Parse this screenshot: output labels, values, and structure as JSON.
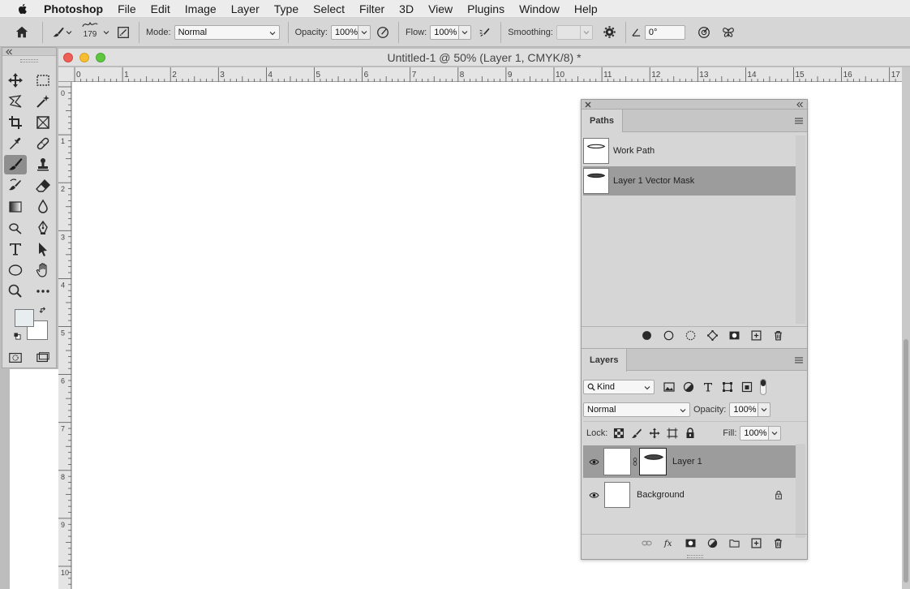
{
  "menubar": {
    "app_name": "Photoshop",
    "items": [
      "File",
      "Edit",
      "Image",
      "Layer",
      "Type",
      "Select",
      "Filter",
      "3D",
      "View",
      "Plugins",
      "Window",
      "Help"
    ]
  },
  "options_bar": {
    "brush_size": "179",
    "mode_label": "Mode:",
    "mode_value": "Normal",
    "opacity_label": "Opacity:",
    "opacity_value": "100%",
    "flow_label": "Flow:",
    "flow_value": "100%",
    "smoothing_label": "Smoothing:",
    "smoothing_value": "",
    "angle_value": "0°"
  },
  "document": {
    "title": "Untitled-1 @ 50% (Layer 1, CMYK/8) *",
    "h_ruler_ticks": [
      "0",
      "1",
      "2",
      "3",
      "4",
      "5",
      "6",
      "7",
      "8",
      "9",
      "10",
      "11",
      "12",
      "13",
      "14",
      "15",
      "16",
      "17"
    ],
    "v_ruler_ticks": [
      "0",
      "1",
      "2",
      "3",
      "4",
      "5",
      "6",
      "7",
      "8",
      "9",
      "10"
    ]
  },
  "colors": {
    "foreground": "#e8eef0",
    "background": "#ffffff",
    "selection": "#9c9c9c"
  },
  "paths_panel": {
    "tab": "Paths",
    "items": [
      {
        "name": "Work Path",
        "selected": false
      },
      {
        "name": "Layer 1 Vector Mask",
        "selected": true
      }
    ]
  },
  "layers_panel": {
    "tab": "Layers",
    "filter_value": "Kind",
    "blend_mode": "Normal",
    "opacity_label": "Opacity:",
    "opacity_value": "100%",
    "lock_label": "Lock:",
    "fill_label": "Fill:",
    "fill_value": "100%",
    "layers": [
      {
        "name": "Layer 1",
        "selected": true
      },
      {
        "name": "Background",
        "selected": false,
        "locked": true
      }
    ]
  }
}
